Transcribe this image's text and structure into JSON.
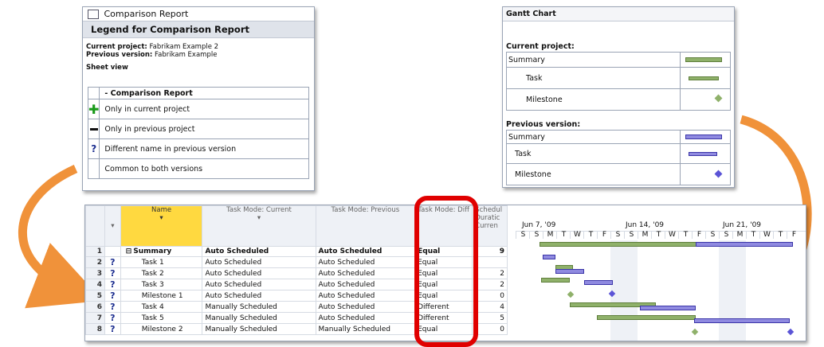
{
  "legend_panel": {
    "title": "Comparison Report",
    "heading": "Legend for Comparison Report",
    "current_project_label": "Current project:",
    "current_project_value": "Fabrikam Example 2",
    "previous_version_label": "Previous version:",
    "previous_version_value": "Fabrikam Example",
    "sheet_view": "Sheet view",
    "table_header": "- Comparison Report",
    "rows": [
      {
        "icon": "plus-icon",
        "text": "Only in current project"
      },
      {
        "icon": "minus-icon",
        "text": "Only in previous project"
      },
      {
        "icon": "question-icon",
        "text": "Different name in previous version"
      },
      {
        "icon": "",
        "text": "Common to both versions"
      }
    ]
  },
  "gantt_legend": {
    "title": "Gantt Chart",
    "current_label": "Current project:",
    "previous_label": "Previous version:",
    "items": [
      "Summary",
      "Task",
      "Milestone"
    ]
  },
  "grid": {
    "columns": [
      "Name",
      "Task Mode: Current",
      "Task Mode: Previous",
      "Task Mode: Diff",
      "Schedul Duratic Curren"
    ],
    "timeline_weeks": [
      "Jun 7, '09",
      "Jun 14, '09",
      "Jun 21, '09"
    ],
    "days": [
      "S",
      "S",
      "M",
      "T",
      "W",
      "T",
      "F",
      "S",
      "S",
      "M",
      "T",
      "W",
      "T",
      "F",
      "S",
      "S",
      "M",
      "T",
      "W",
      "T",
      "F"
    ],
    "rows": [
      {
        "num": "1",
        "q": "",
        "name": "Summary",
        "cur": "Auto Scheduled",
        "prev": "Auto Scheduled",
        "diff": "Equal",
        "dur": "9"
      },
      {
        "num": "2",
        "q": "?",
        "name": "Task 1",
        "cur": "Auto Scheduled",
        "prev": "Auto Scheduled",
        "diff": "Equal",
        "dur": ""
      },
      {
        "num": "3",
        "q": "?",
        "name": "Task 2",
        "cur": "Auto Scheduled",
        "prev": "Auto Scheduled",
        "diff": "Equal",
        "dur": "2"
      },
      {
        "num": "4",
        "q": "?",
        "name": "Task 3",
        "cur": "Auto Scheduled",
        "prev": "Auto Scheduled",
        "diff": "Equal",
        "dur": "2"
      },
      {
        "num": "5",
        "q": "?",
        "name": "Milestone 1",
        "cur": "Auto Scheduled",
        "prev": "Auto Scheduled",
        "diff": "Equal",
        "dur": "0"
      },
      {
        "num": "6",
        "q": "?",
        "name": "Task 4",
        "cur": "Manually Scheduled",
        "prev": "Auto Scheduled",
        "diff": "Different",
        "dur": "4"
      },
      {
        "num": "7",
        "q": "?",
        "name": "Task 5",
        "cur": "Manually Scheduled",
        "prev": "Auto Scheduled",
        "diff": "Different",
        "dur": "5"
      },
      {
        "num": "8",
        "q": "?",
        "name": "Milestone 2",
        "cur": "Manually Scheduled",
        "prev": "Manually Scheduled",
        "diff": "Equal",
        "dur": "0"
      }
    ]
  },
  "colors": {
    "highlight": "#e00000",
    "arrow": "#f0923a",
    "name_header": "#ffd940"
  }
}
